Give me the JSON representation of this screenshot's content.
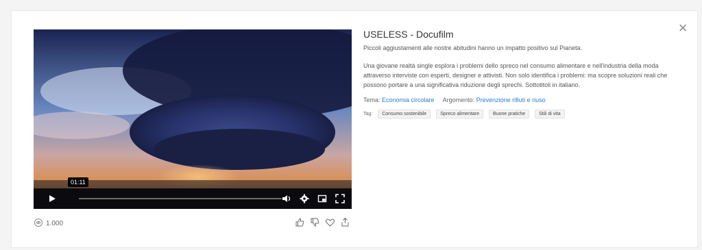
{
  "video": {
    "current_time": "01:11",
    "progress": 0
  },
  "stats": {
    "views": "1.000"
  },
  "info": {
    "title": "USELESS - Docufilm",
    "subtitle": "Piccoli aggiustamenti alle nostre abitudini hanno un impatto positivo sul Pianeta.",
    "description": "Una giovane realtà single esplora i problemi dello spreco nel consumo alimentare e nell'industria della moda attraverso interviste con esperti, designer e attivisti. Non solo identifica i problemi: ma scopre soluzioni reali che possono portare a una significativa riduzione degli sprechi. Sottotitoli in italiano.",
    "tema_label": "Tema:",
    "tema_value": "Economia circolare",
    "argomento_label": "Argomento:",
    "argomento_value": "Prevenzione rifiuti e riuso",
    "tags_label": "Tag:",
    "tags": [
      "Consumo sostenibile",
      "Spreco alimentare",
      "Buone pratiche",
      "Stili di vita"
    ]
  },
  "icons": {
    "close": "close-icon",
    "play": "play-icon",
    "volume": "volume-icon",
    "settings": "gear-icon",
    "miniplayer": "miniplayer-icon",
    "fullscreen": "fullscreen-icon",
    "views": "eye-icon",
    "like": "thumbs-up-icon",
    "dislike": "thumbs-down-icon",
    "favorite": "heart-icon",
    "share": "share-icon"
  }
}
